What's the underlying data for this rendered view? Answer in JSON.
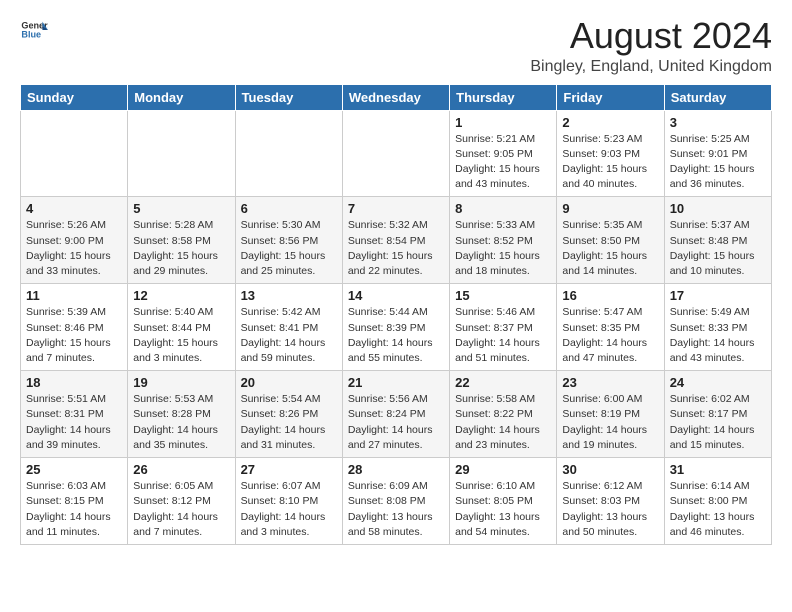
{
  "header": {
    "logo_line1": "General",
    "logo_line2": "Blue",
    "month_year": "August 2024",
    "location": "Bingley, England, United Kingdom"
  },
  "days_of_week": [
    "Sunday",
    "Monday",
    "Tuesday",
    "Wednesday",
    "Thursday",
    "Friday",
    "Saturday"
  ],
  "weeks": [
    [
      {
        "day": "",
        "info": ""
      },
      {
        "day": "",
        "info": ""
      },
      {
        "day": "",
        "info": ""
      },
      {
        "day": "",
        "info": ""
      },
      {
        "day": "1",
        "info": "Sunrise: 5:21 AM\nSunset: 9:05 PM\nDaylight: 15 hours\nand 43 minutes."
      },
      {
        "day": "2",
        "info": "Sunrise: 5:23 AM\nSunset: 9:03 PM\nDaylight: 15 hours\nand 40 minutes."
      },
      {
        "day": "3",
        "info": "Sunrise: 5:25 AM\nSunset: 9:01 PM\nDaylight: 15 hours\nand 36 minutes."
      }
    ],
    [
      {
        "day": "4",
        "info": "Sunrise: 5:26 AM\nSunset: 9:00 PM\nDaylight: 15 hours\nand 33 minutes."
      },
      {
        "day": "5",
        "info": "Sunrise: 5:28 AM\nSunset: 8:58 PM\nDaylight: 15 hours\nand 29 minutes."
      },
      {
        "day": "6",
        "info": "Sunrise: 5:30 AM\nSunset: 8:56 PM\nDaylight: 15 hours\nand 25 minutes."
      },
      {
        "day": "7",
        "info": "Sunrise: 5:32 AM\nSunset: 8:54 PM\nDaylight: 15 hours\nand 22 minutes."
      },
      {
        "day": "8",
        "info": "Sunrise: 5:33 AM\nSunset: 8:52 PM\nDaylight: 15 hours\nand 18 minutes."
      },
      {
        "day": "9",
        "info": "Sunrise: 5:35 AM\nSunset: 8:50 PM\nDaylight: 15 hours\nand 14 minutes."
      },
      {
        "day": "10",
        "info": "Sunrise: 5:37 AM\nSunset: 8:48 PM\nDaylight: 15 hours\nand 10 minutes."
      }
    ],
    [
      {
        "day": "11",
        "info": "Sunrise: 5:39 AM\nSunset: 8:46 PM\nDaylight: 15 hours\nand 7 minutes."
      },
      {
        "day": "12",
        "info": "Sunrise: 5:40 AM\nSunset: 8:44 PM\nDaylight: 15 hours\nand 3 minutes."
      },
      {
        "day": "13",
        "info": "Sunrise: 5:42 AM\nSunset: 8:41 PM\nDaylight: 14 hours\nand 59 minutes."
      },
      {
        "day": "14",
        "info": "Sunrise: 5:44 AM\nSunset: 8:39 PM\nDaylight: 14 hours\nand 55 minutes."
      },
      {
        "day": "15",
        "info": "Sunrise: 5:46 AM\nSunset: 8:37 PM\nDaylight: 14 hours\nand 51 minutes."
      },
      {
        "day": "16",
        "info": "Sunrise: 5:47 AM\nSunset: 8:35 PM\nDaylight: 14 hours\nand 47 minutes."
      },
      {
        "day": "17",
        "info": "Sunrise: 5:49 AM\nSunset: 8:33 PM\nDaylight: 14 hours\nand 43 minutes."
      }
    ],
    [
      {
        "day": "18",
        "info": "Sunrise: 5:51 AM\nSunset: 8:31 PM\nDaylight: 14 hours\nand 39 minutes."
      },
      {
        "day": "19",
        "info": "Sunrise: 5:53 AM\nSunset: 8:28 PM\nDaylight: 14 hours\nand 35 minutes."
      },
      {
        "day": "20",
        "info": "Sunrise: 5:54 AM\nSunset: 8:26 PM\nDaylight: 14 hours\nand 31 minutes."
      },
      {
        "day": "21",
        "info": "Sunrise: 5:56 AM\nSunset: 8:24 PM\nDaylight: 14 hours\nand 27 minutes."
      },
      {
        "day": "22",
        "info": "Sunrise: 5:58 AM\nSunset: 8:22 PM\nDaylight: 14 hours\nand 23 minutes."
      },
      {
        "day": "23",
        "info": "Sunrise: 6:00 AM\nSunset: 8:19 PM\nDaylight: 14 hours\nand 19 minutes."
      },
      {
        "day": "24",
        "info": "Sunrise: 6:02 AM\nSunset: 8:17 PM\nDaylight: 14 hours\nand 15 minutes."
      }
    ],
    [
      {
        "day": "25",
        "info": "Sunrise: 6:03 AM\nSunset: 8:15 PM\nDaylight: 14 hours\nand 11 minutes."
      },
      {
        "day": "26",
        "info": "Sunrise: 6:05 AM\nSunset: 8:12 PM\nDaylight: 14 hours\nand 7 minutes."
      },
      {
        "day": "27",
        "info": "Sunrise: 6:07 AM\nSunset: 8:10 PM\nDaylight: 14 hours\nand 3 minutes."
      },
      {
        "day": "28",
        "info": "Sunrise: 6:09 AM\nSunset: 8:08 PM\nDaylight: 13 hours\nand 58 minutes."
      },
      {
        "day": "29",
        "info": "Sunrise: 6:10 AM\nSunset: 8:05 PM\nDaylight: 13 hours\nand 54 minutes."
      },
      {
        "day": "30",
        "info": "Sunrise: 6:12 AM\nSunset: 8:03 PM\nDaylight: 13 hours\nand 50 minutes."
      },
      {
        "day": "31",
        "info": "Sunrise: 6:14 AM\nSunset: 8:00 PM\nDaylight: 13 hours\nand 46 minutes."
      }
    ]
  ]
}
